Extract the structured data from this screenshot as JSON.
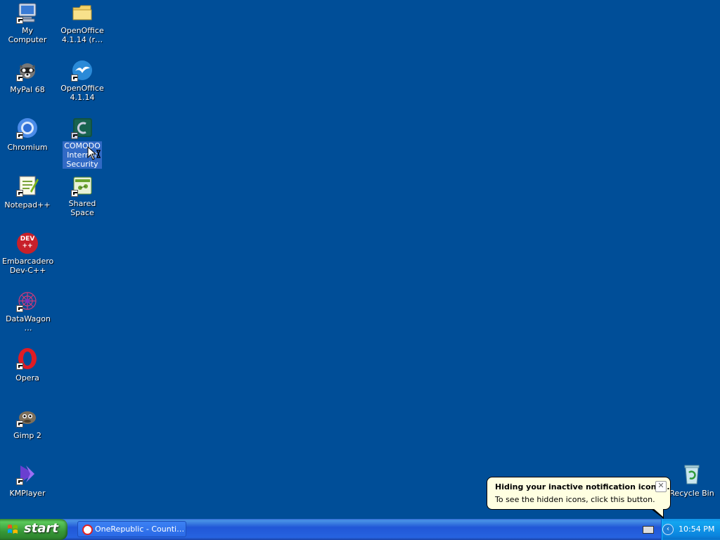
{
  "desktop": {
    "icons": [
      {
        "label": "My Computer",
        "icon": "computer-icon"
      },
      {
        "label": "OpenOffice\n4.1.14 (r…",
        "icon": "folder-icon"
      },
      {
        "label": "MyPal 68",
        "icon": "raccoon-icon"
      },
      {
        "label": "OpenOffice\n4.1.14",
        "icon": "openoffice-gull-icon"
      },
      {
        "label": "Chromium",
        "icon": "chromium-icon"
      },
      {
        "label": "COMODO\nInternet\nSecurity",
        "icon": "comodo-icon"
      },
      {
        "label": "Notepad++",
        "icon": "notepad-icon"
      },
      {
        "label": "Shared Space",
        "icon": "shared-space-icon"
      },
      {
        "label": "Embarcadero\nDev-C++",
        "icon": "devcpp-icon",
        "badge": "DEV\n++"
      },
      {
        "label": "DataWagon…",
        "icon": "datawagon-icon"
      },
      {
        "label": "Opera",
        "icon": "opera-icon"
      },
      {
        "label": "Gimp 2",
        "icon": "gimp-icon"
      },
      {
        "label": "KMPlayer",
        "icon": "kmplayer-icon"
      },
      {
        "label": "Recycle Bin",
        "icon": "recycle-bin-icon"
      }
    ],
    "selected_icon": "COMODO Internet Security"
  },
  "taskbar": {
    "start_label": "start",
    "task_button_label": "OneRepublic - Counti…",
    "clock": "10:54 PM"
  },
  "balloon": {
    "title": "Hiding your inactive notification icons...",
    "body": "To see the hidden icons, click this button.",
    "close_symbol": "✕"
  },
  "colors": {
    "desktop_bg": "#004e98",
    "taskbar_blue": "#2157d7",
    "start_green": "#379837",
    "tray_blue": "#0b84de",
    "balloon_bg": "#ffffe1"
  }
}
